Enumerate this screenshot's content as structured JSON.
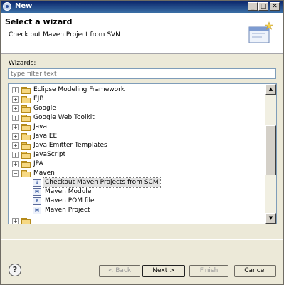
{
  "window": {
    "title": "New",
    "controls": {
      "minimize": "_",
      "maximize": "□",
      "close": "✕"
    }
  },
  "header": {
    "title": "Select a wizard",
    "subtitle": "Check out Maven Project from SVN"
  },
  "wizards_label": "Wizards:",
  "filter": {
    "placeholder": "type filter text",
    "value": ""
  },
  "tree": {
    "items": [
      {
        "label": "Eclipse Modeling Framework",
        "type": "folder",
        "expanded": false
      },
      {
        "label": "EJB",
        "type": "folder",
        "expanded": false
      },
      {
        "label": "Google",
        "type": "folder",
        "expanded": false
      },
      {
        "label": "Google Web Toolkit",
        "type": "folder",
        "expanded": false
      },
      {
        "label": "Java",
        "type": "folder",
        "expanded": false
      },
      {
        "label": "Java EE",
        "type": "folder",
        "expanded": false
      },
      {
        "label": "Java Emitter Templates",
        "type": "folder",
        "expanded": false
      },
      {
        "label": "JavaScript",
        "type": "folder",
        "expanded": false
      },
      {
        "label": "JPA",
        "type": "folder",
        "expanded": false
      },
      {
        "label": "Maven",
        "type": "folder",
        "expanded": true
      },
      {
        "label": "Checkout Maven Projects from SCM",
        "type": "item",
        "selected": true
      },
      {
        "label": "Maven Module",
        "type": "item"
      },
      {
        "label": "Maven POM file",
        "type": "item"
      },
      {
        "label": "Maven Project",
        "type": "item"
      }
    ]
  },
  "buttons": {
    "help": "?",
    "back": "< Back",
    "next": "Next >",
    "finish": "Finish",
    "cancel": "Cancel"
  },
  "colors": {
    "titlebar": "#0a246a",
    "selection": "#e4e4e4"
  }
}
